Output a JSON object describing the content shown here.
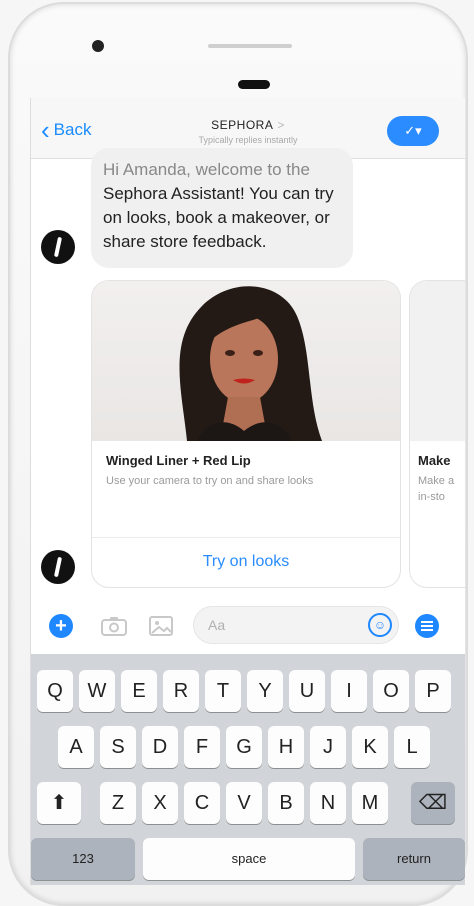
{
  "nav": {
    "back_label": "Back",
    "title": "SEPHORA",
    "title_caret": ">",
    "subtitle": "Typically replies instantly",
    "action_icon": "✓▾"
  },
  "message": {
    "line1": "Hi Amanda, welcome to the",
    "rest": "Sephora Assistant! You can try on looks, book a makeover, or share store feedback."
  },
  "cards": [
    {
      "title": "Winged Liner + Red Lip",
      "description": "Use your camera to try on and share looks",
      "button": "Try on looks"
    },
    {
      "title": "Make",
      "description_line1": "Make a",
      "description_line2": "in-sto"
    }
  ],
  "composer": {
    "placeholder": "Aa",
    "plus": "+",
    "smiley": "☺"
  },
  "keyboard": {
    "row1": [
      "Q",
      "W",
      "E",
      "R",
      "T",
      "Y",
      "U",
      "I",
      "O",
      "P"
    ],
    "row2": [
      "A",
      "S",
      "D",
      "F",
      "G",
      "H",
      "J",
      "K",
      "L"
    ],
    "row3": [
      "Z",
      "X",
      "C",
      "V",
      "B",
      "N",
      "M"
    ],
    "shift": "⬆",
    "backspace": "⌫",
    "numbers": "123",
    "space": "space",
    "return": "return"
  }
}
